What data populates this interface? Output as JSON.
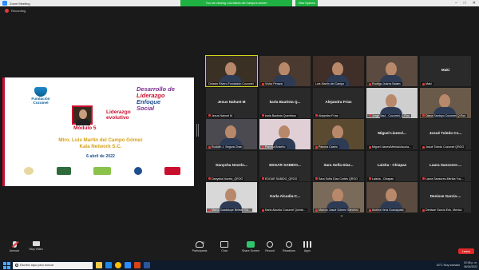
{
  "window": {
    "title": "Zoom Meeting",
    "share_banner": "You are viewing Luis Martín del Campo's screen",
    "view_options": "View Options"
  },
  "recording": {
    "label": "Recording"
  },
  "slide": {
    "org_line1": "Fundación",
    "org_line2": "Cozumel",
    "title_line1": "Desarrollo de",
    "title_line2": "Liderazgo",
    "title_line3": "Enfoque",
    "title_line4": "Social",
    "module": "Módulo 5",
    "module_sub1": "Liderazgo",
    "module_sub2": "evolutivo",
    "speaker": "Mtro. Luis Martín del Campo Gómez",
    "organization": "Kala Network S.C.",
    "date": "6 abril de 2022"
  },
  "gallery": {
    "tiles": [
      {
        "label": "Octavio Rivero Fundación Cozumel",
        "bigname": "",
        "video": true,
        "active": true,
        "bg": "#3b3024",
        "muted": false
      },
      {
        "label": "Víctor Peraza",
        "bigname": "",
        "video": true,
        "active": false,
        "bg": "#4a3a30",
        "muted": true
      },
      {
        "label": "Luis Martín del Campo",
        "bigname": "",
        "video": true,
        "active": false,
        "bg": "#3f2f28",
        "muted": false
      },
      {
        "label": "Rodrigo Juárez Balam",
        "bigname": "",
        "video": true,
        "active": false,
        "bg": "#5a4a40",
        "muted": true
      },
      {
        "label": "Maki",
        "bigname": "Maki",
        "video": false,
        "active": false,
        "bg": "#2a2a2a",
        "muted": true
      },
      {
        "label": "Jesus Nahuet M",
        "bigname": "Jesus Nahuet M",
        "video": false,
        "active": false,
        "bg": "#2a2a2a",
        "muted": true
      },
      {
        "label": "karla Bautista Querétaro",
        "bigname": "karla Bautista Q...",
        "video": false,
        "active": false,
        "bg": "#2a2a2a",
        "muted": true
      },
      {
        "label": "Alejandra Frías",
        "bigname": "Alejandra Frías",
        "video": false,
        "active": false,
        "bg": "#2a2a2a",
        "muted": true
      },
      {
        "label": "Jorge Saul - Cozumel_Q.Roo",
        "bigname": "",
        "video": true,
        "active": false,
        "bg": "#cfcfcf",
        "muted": true
      },
      {
        "label": "Diana Santoyo Cozumel Q.Roo",
        "bigname": "",
        "video": true,
        "active": false,
        "bg": "#6a5a4a",
        "muted": true
      },
      {
        "label": "Rodolfo J. Segura Chan",
        "bigname": "",
        "video": true,
        "active": false,
        "bg": "#4a4a50",
        "muted": true
      },
      {
        "label": "Pamela Briseño",
        "bigname": "",
        "video": true,
        "active": false,
        "bg": "#e0d0d6",
        "muted": true
      },
      {
        "label": "Paloma Castro",
        "bigname": "",
        "video": true,
        "active": false,
        "bg": "#5a4a30",
        "muted": true
      },
      {
        "label": "Miguel Llanes/Mérida/Asocia...",
        "bigname": "Miguel Llanes/...",
        "video": false,
        "active": false,
        "bg": "#2a2a2a",
        "muted": true
      },
      {
        "label": "Josué Toledo Cozumel QROO",
        "bigname": "Josué Toledo Co...",
        "video": false,
        "active": false,
        "bg": "#2a2a2a",
        "muted": true
      },
      {
        "label": "Danysha Novelo_QROO",
        "bigname": "Danysha Novelo...",
        "video": false,
        "active": false,
        "bg": "#2a2a2a",
        "muted": true
      },
      {
        "label": "EDGAR SABIDO_QROO",
        "bigname": "EDGAR SABIDO...",
        "video": false,
        "active": false,
        "bg": "#2a2a2a",
        "muted": true
      },
      {
        "label": "Sara Sofía Díaz Cortés QROO",
        "bigname": "Sara Sofía Díaz...",
        "video": false,
        "active": false,
        "bg": "#2a2a2a",
        "muted": true
      },
      {
        "label": "Laisha - Chiapas",
        "bigname": "Laisha - Chiapas",
        "video": false,
        "active": false,
        "bg": "#2a2a2a",
        "muted": true
      },
      {
        "label": "Laura Sansores-Mérida Yuc...",
        "bigname": "Laura Sansores-...",
        "video": false,
        "active": false,
        "bg": "#2a2a2a",
        "muted": true
      },
      {
        "label": "María Guadalupe Beltrán Gó...",
        "bigname": "",
        "video": true,
        "active": false,
        "bg": "#d8d8d8",
        "muted": true
      },
      {
        "label": "Karla Alcudia Cozumel Quinta...",
        "bigname": "Karla Alcudia-C...",
        "video": false,
        "active": false,
        "bg": "#2a2a2a",
        "muted": true
      },
      {
        "label": "Marcos Josué Gómez Sánchez",
        "bigname": "",
        "video": true,
        "active": false,
        "bg": "#7a6a5a",
        "muted": true
      },
      {
        "label": "Andrea Vera Guanajuato",
        "bigname": "",
        "video": true,
        "active": false,
        "bg": "#5a4a40",
        "muted": true
      },
      {
        "label": "Denisse García Edo. Mexico",
        "bigname": "Denisse García-...",
        "video": false,
        "active": false,
        "bg": "#2a2a2a",
        "muted": true
      }
    ]
  },
  "toolbar": {
    "unmute": "Unmute",
    "stop_video": "Stop Video",
    "participants": "Participants",
    "participants_count": "45",
    "chat": "Chat",
    "share_screen": "Share Screen",
    "record": "Record",
    "reactions": "Reactions",
    "apps": "Apps",
    "leave": "Leave"
  },
  "taskbar": {
    "search_placeholder": "Escribe aquí para buscar",
    "weather": "30°C Muy soleado",
    "time": "02:08 p. m.",
    "date": "06/04/2022"
  }
}
